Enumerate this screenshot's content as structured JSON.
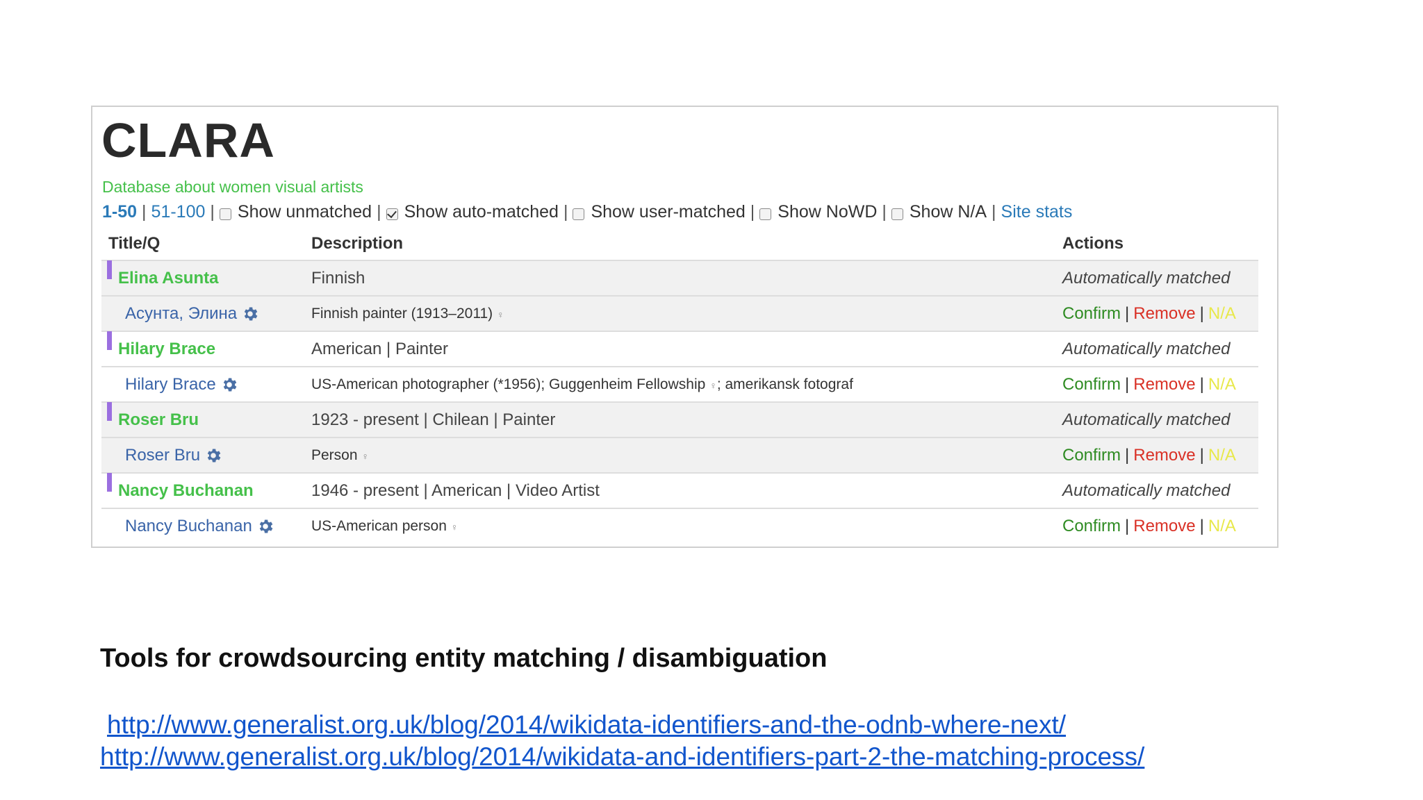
{
  "app": {
    "title": "CLARA",
    "subtitle": "Database about women visual artists"
  },
  "filters": {
    "page_current": "1-50",
    "page_next": "51-100",
    "checkboxes": [
      {
        "label": "Show unmatched",
        "checked": false
      },
      {
        "label": "Show auto-matched",
        "checked": true
      },
      {
        "label": "Show user-matched",
        "checked": false
      },
      {
        "label": "Show NoWD",
        "checked": false
      },
      {
        "label": "Show N/A",
        "checked": false
      }
    ],
    "site_stats": "Site stats"
  },
  "table": {
    "headers": {
      "title": "Title/Q",
      "description": "Description",
      "actions": "Actions"
    },
    "entries": [
      {
        "title": "Elina Asunta",
        "description": "Finnish",
        "status": "Automatically matched",
        "match_name": "Асунта, Элина",
        "match_description": "Finnish painter (1913–2011)",
        "match_symbol": "♀"
      },
      {
        "title": "Hilary Brace",
        "description": "American | Painter",
        "status": "Automatically matched",
        "match_name": "Hilary Brace",
        "match_description": "US-American photographer (*1956); Guggenheim Fellowship",
        "match_symbol": "♀",
        "match_description_tail": "; amerikansk fotograf"
      },
      {
        "title": "Roser Bru",
        "description": "1923 - present | Chilean | Painter",
        "status": "Automatically matched",
        "match_name": "Roser Bru",
        "match_description": "Person",
        "match_symbol": "♀"
      },
      {
        "title": "Nancy Buchanan",
        "description": "1946 - present | American | Video Artist",
        "status": "Automatically matched",
        "match_name": "Nancy Buchanan",
        "match_description": "US-American person",
        "match_symbol": "♀"
      }
    ],
    "actions": {
      "confirm": "Confirm",
      "remove": "Remove",
      "na": "N/A",
      "separator": "|"
    }
  },
  "colors": {
    "title_green": "#45c04a",
    "link_blue": "#2a7ab8",
    "match_blue": "#3a64a8",
    "marker_purple": "#9b6fe0",
    "confirm_green": "#2e8b22",
    "remove_red": "#d93025",
    "na_yellow": "#e8e84a"
  },
  "icons": {
    "match": "gear-icon",
    "gender": "female-sign-icon"
  },
  "slide": {
    "heading": "Tools for crowdsourcing entity matching / disambiguation",
    "links": [
      "http://www.generalist.org.uk/blog/2014/wikidata-identifiers-and-the-odnb-where-next/",
      "http://www.generalist.org.uk/blog/2014/wikidata-and-identifiers-part-2-the-matching-process/"
    ]
  }
}
